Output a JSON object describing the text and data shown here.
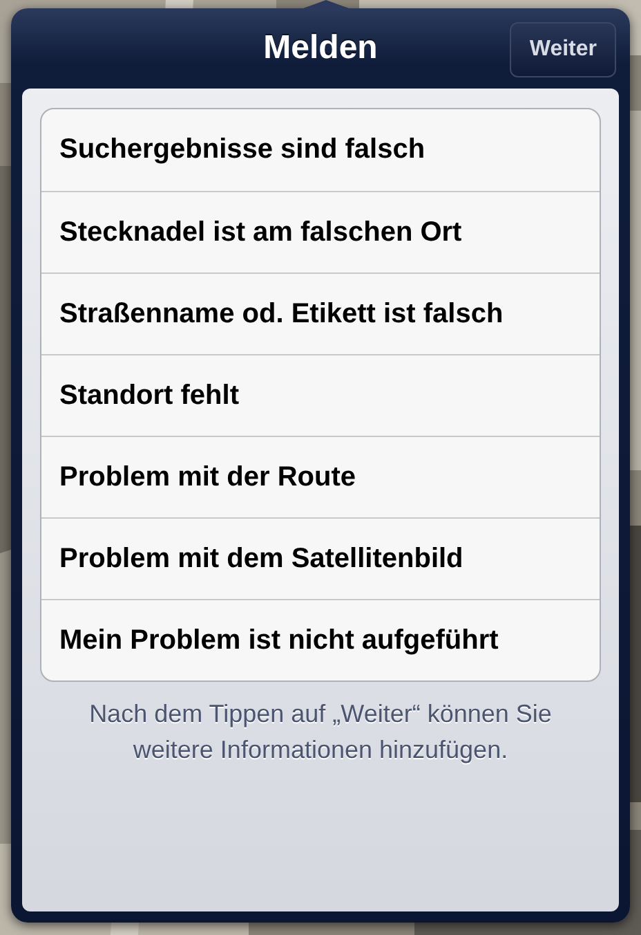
{
  "popover": {
    "title": "Melden",
    "button": "Weiter"
  },
  "items": [
    {
      "label": "Suchergebnisse sind falsch"
    },
    {
      "label": "Stecknadel ist am falschen Ort"
    },
    {
      "label": "Straßenname od. Etikett ist falsch"
    },
    {
      "label": "Standort fehlt"
    },
    {
      "label": "Problem mit der Route"
    },
    {
      "label": "Problem mit dem Satellitenbild"
    },
    {
      "label": "Mein Problem ist nicht aufgeführt"
    }
  ],
  "footer": "Nach dem Tippen auf „Weiter“ können Sie weitere Informationen hinzufügen."
}
